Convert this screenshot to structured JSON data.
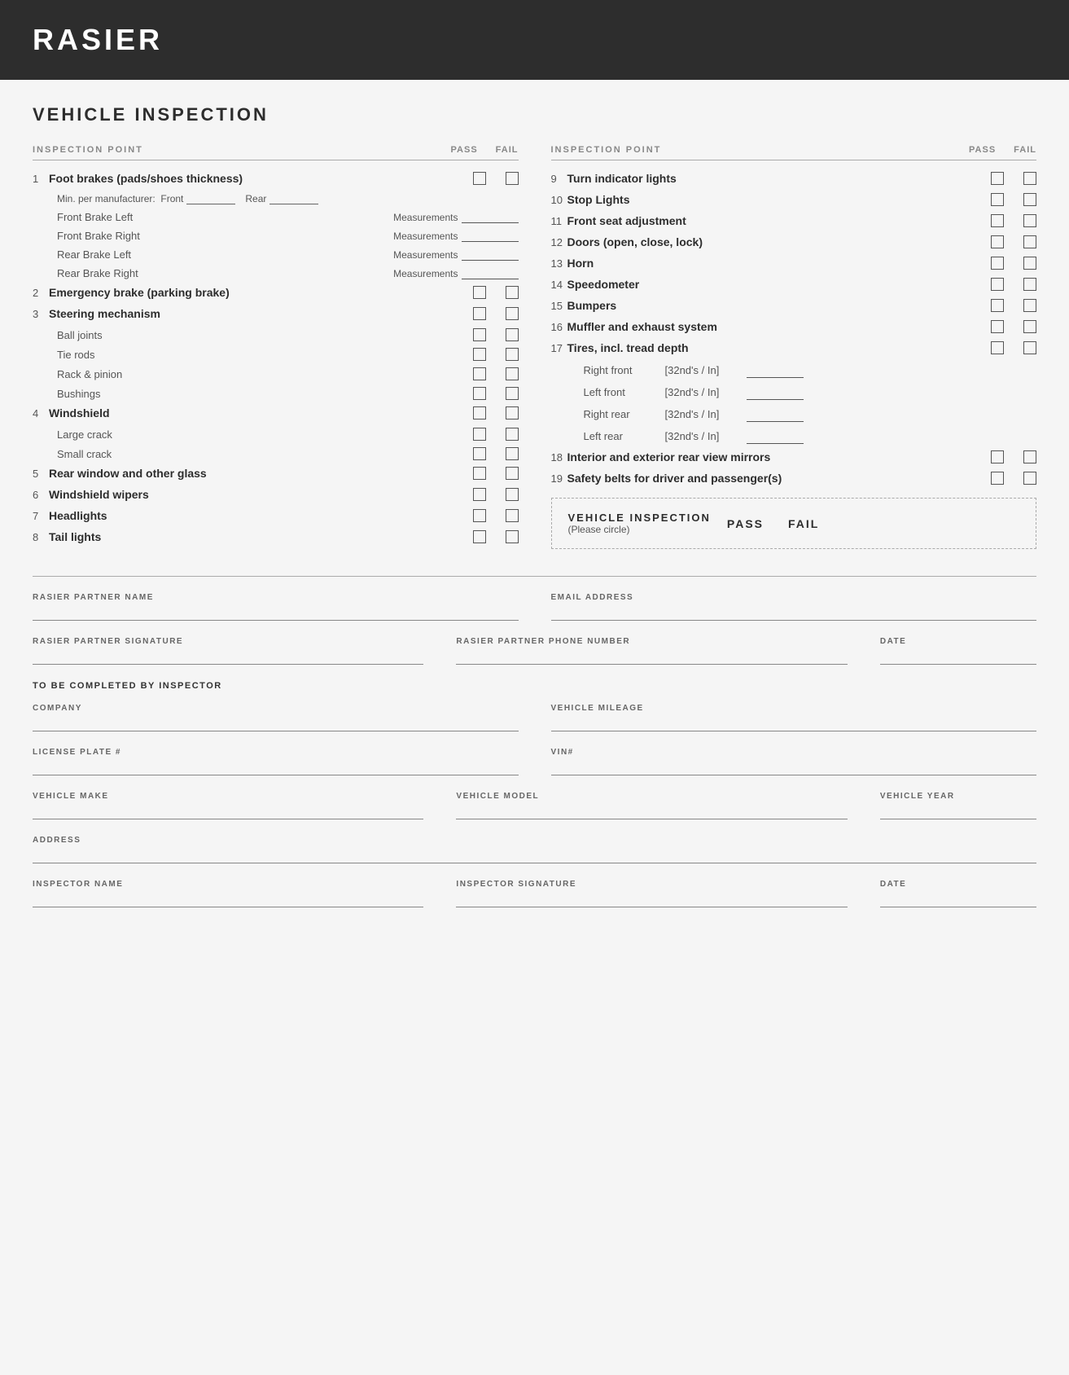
{
  "header": {
    "title": "RASIER"
  },
  "page": {
    "section_title": "VEHICLE INSPECTION"
  },
  "columns": {
    "left_header": "INSPECTION POINT",
    "right_header": "INSPECTION POINT",
    "pass_label": "PASS",
    "fail_label": "FAIL"
  },
  "left_items": [
    {
      "number": "1",
      "label": "Foot brakes (pads/shoes thickness)",
      "bold": true,
      "has_checkboxes": true
    },
    {
      "number": "",
      "label": "Min. per manufacturer:",
      "bold": false,
      "has_checkboxes": false,
      "type": "minmeas"
    },
    {
      "number": "",
      "label": "Front Brake Left",
      "bold": false,
      "has_checkboxes": false,
      "type": "meas"
    },
    {
      "number": "",
      "label": "Front Brake Right",
      "bold": false,
      "has_checkboxes": false,
      "type": "meas"
    },
    {
      "number": "",
      "label": "Rear Brake Left",
      "bold": false,
      "has_checkboxes": false,
      "type": "meas"
    },
    {
      "number": "",
      "label": "Rear Brake Right",
      "bold": false,
      "has_checkboxes": false,
      "type": "meas"
    },
    {
      "number": "2",
      "label": "Emergency brake (parking brake)",
      "bold": true,
      "has_checkboxes": true
    },
    {
      "number": "3",
      "label": "Steering mechanism",
      "bold": true,
      "has_checkboxes": true
    },
    {
      "number": "",
      "label": "Ball joints",
      "bold": false,
      "has_checkboxes": true,
      "type": "sub"
    },
    {
      "number": "",
      "label": "Tie rods",
      "bold": false,
      "has_checkboxes": true,
      "type": "sub"
    },
    {
      "number": "",
      "label": "Rack & pinion",
      "bold": false,
      "has_checkboxes": true,
      "type": "sub"
    },
    {
      "number": "",
      "label": "Bushings",
      "bold": false,
      "has_checkboxes": true,
      "type": "sub"
    },
    {
      "number": "4",
      "label": "Windshield",
      "bold": true,
      "has_checkboxes": true
    },
    {
      "number": "",
      "label": "Large crack",
      "bold": false,
      "has_checkboxes": true,
      "type": "sub"
    },
    {
      "number": "",
      "label": "Small crack",
      "bold": false,
      "has_checkboxes": true,
      "type": "sub"
    },
    {
      "number": "5",
      "label": "Rear window and other glass",
      "bold": true,
      "has_checkboxes": true
    },
    {
      "number": "6",
      "label": "Windshield wipers",
      "bold": true,
      "has_checkboxes": true
    },
    {
      "number": "7",
      "label": "Headlights",
      "bold": true,
      "has_checkboxes": true
    },
    {
      "number": "8",
      "label": "Tail lights",
      "bold": true,
      "has_checkboxes": true
    }
  ],
  "right_items": [
    {
      "number": "9",
      "label": "Turn indicator lights",
      "bold": true,
      "has_checkboxes": true
    },
    {
      "number": "10",
      "label": "Stop Lights",
      "bold": true,
      "has_checkboxes": true
    },
    {
      "number": "11",
      "label": "Front seat adjustment",
      "bold": true,
      "has_checkboxes": true
    },
    {
      "number": "12",
      "label": "Doors (open, close, lock)",
      "bold": true,
      "has_checkboxes": true
    },
    {
      "number": "13",
      "label": "Horn",
      "bold": true,
      "has_checkboxes": true
    },
    {
      "number": "14",
      "label": "Speedometer",
      "bold": true,
      "has_checkboxes": true
    },
    {
      "number": "15",
      "label": "Bumpers",
      "bold": true,
      "has_checkboxes": true
    },
    {
      "number": "16",
      "label": "Muffler and exhaust system",
      "bold": true,
      "has_checkboxes": true
    },
    {
      "number": "17",
      "label": "Tires, incl. tread depth",
      "bold": true,
      "has_checkboxes": true
    },
    {
      "number": "",
      "label": "Right front",
      "unit": "[32nd's / In]",
      "type": "tire"
    },
    {
      "number": "",
      "label": "Left front",
      "unit": "[32nd's / In]",
      "type": "tire"
    },
    {
      "number": "",
      "label": "Right rear",
      "unit": "[32nd's / In]",
      "type": "tire"
    },
    {
      "number": "",
      "label": "Left rear",
      "unit": "[32nd's / In]",
      "type": "tire"
    },
    {
      "number": "18",
      "label": "Interior and exterior rear view mirrors",
      "bold": true,
      "has_checkboxes": true
    },
    {
      "number": "19",
      "label": "Safety belts for driver and passenger(s)",
      "bold": true,
      "has_checkboxes": true
    }
  ],
  "summary": {
    "title": "VEHICLE INSPECTION",
    "subtitle": "(Please circle)",
    "pass_label": "PASS",
    "fail_label": "FAIL"
  },
  "form": {
    "partner_name_label": "RASIER PARTNER NAME",
    "email_label": "EMAIL ADDRESS",
    "signature_label": "RASIER PARTNER SIGNATURE",
    "phone_label": "RASIER PARTNER PHONE NUMBER",
    "date_label": "DATE",
    "inspector_note": "TO BE COMPLETED BY INSPECTOR",
    "company_label": "COMPANY",
    "mileage_label": "VEHICLE MILEAGE",
    "license_label": "LICENSE PLATE #",
    "vin_label": "VIN#",
    "make_label": "VEHICLE MAKE",
    "model_label": "VEHICLE MODEL",
    "year_label": "VEHICLE YEAR",
    "address_label": "ADDRESS",
    "inspector_name_label": "INSPECTOR NAME",
    "inspector_sig_label": "INSPECTOR SIGNATURE",
    "inspector_date_label": "DATE"
  }
}
